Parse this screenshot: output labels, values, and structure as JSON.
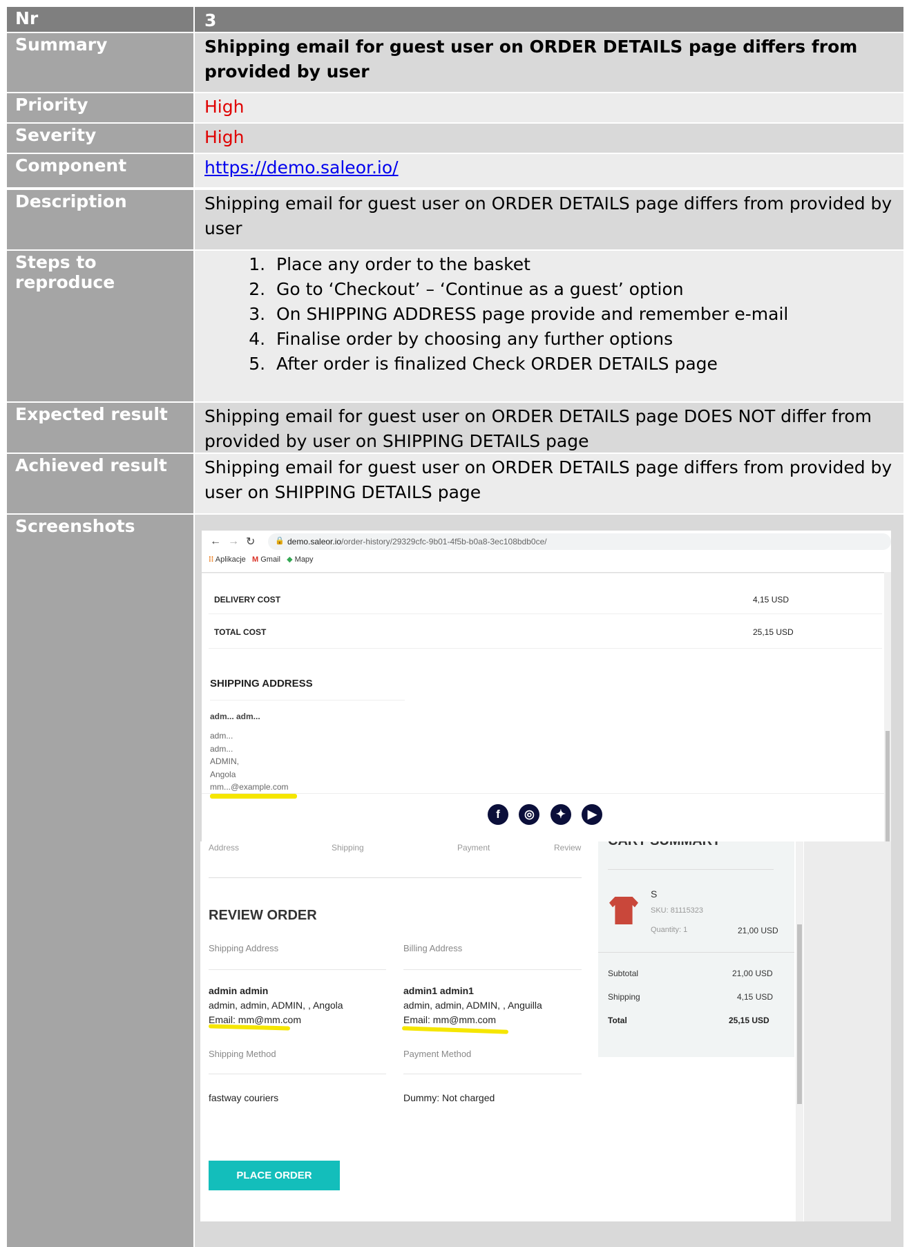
{
  "rows": {
    "nr": {
      "label": "Nr",
      "value": "3"
    },
    "summary": {
      "label": "Summary",
      "value": "Shipping email for guest user on ORDER DETAILS page differs from provided by user"
    },
    "priority": {
      "label": "Priority",
      "value": "High"
    },
    "severity": {
      "label": "Severity",
      "value": "High"
    },
    "component": {
      "label": "Component",
      "value": "https://demo.saleor.io/"
    },
    "description": {
      "label": "Description",
      "value": "Shipping email for guest user on ORDER DETAILS page differs from provided by user"
    },
    "steps": {
      "label": "Steps to reproduce",
      "items": [
        "Place any order to the basket",
        "Go to ‘Checkout’ – ‘Continue as a guest’ option",
        "On  SHIPPING ADDRESS page provide and remember e-mail",
        "Finalise order by choosing any further options",
        "After order is finalized Check ORDER DETAILS page"
      ]
    },
    "expected": {
      "label": "Expected result",
      "value": "Shipping email for guest user on ORDER DETAILS page DOES NOT differ from provided by user on SHIPPING DETAILS page"
    },
    "achieved": {
      "label": "Achieved result",
      "value": "Shipping email for guest user on ORDER DETAILS page differs from provided by user on SHIPPING DETAILS page"
    },
    "screenshots": {
      "label": "Screenshots"
    }
  },
  "shot1": {
    "url_host": "demo.saleor.io",
    "url_path": "/order-history/29329cfc-9b01-4f5b-b0a8-3ec108bdb0ce/",
    "bookmarks": [
      "Aplikacje",
      "Gmail",
      "Mapy"
    ],
    "delivery_label": "DELIVERY COST",
    "delivery_value": "4,15 USD",
    "total_label": "TOTAL COST",
    "total_value": "25,15 USD",
    "shipping_title": "SHIPPING ADDRESS",
    "address_name": "adm... adm...",
    "address_lines": [
      "adm...",
      "adm...",
      "ADMIN,",
      "Angola",
      "mm...@example.com"
    ],
    "social_icons": [
      "facebook-icon",
      "instagram-icon",
      "twitter-icon",
      "youtube-icon"
    ]
  },
  "shot2": {
    "steps": [
      "Address",
      "Shipping",
      "Payment",
      "Review"
    ],
    "cart_title": "CART SUMMARY",
    "review_title": "REVIEW ORDER",
    "shipping_address_label": "Shipping Address",
    "billing_address_label": "Billing Address",
    "ship_name": "admin admin",
    "ship_line": "admin, admin, ADMIN, , Angola",
    "ship_email": "Email: mm@mm.com",
    "bill_name": "admin1 admin1",
    "bill_line": "admin, admin, ADMIN, , Anguilla",
    "bill_email": "Email: mm@mm.com",
    "shipping_method_label": "Shipping Method",
    "shipping_method": "fastway couriers",
    "payment_method_label": "Payment Method",
    "payment_method": "Dummy: Not charged",
    "place_order": "PLACE ORDER",
    "product_name": "S",
    "sku": "SKU: 81115323",
    "quantity": "Quantity: 1",
    "product_price": "21,00 USD",
    "subtotal_label": "Subtotal",
    "subtotal_value": "21,00 USD",
    "shipping_label": "Shipping",
    "shipping_value": "4,15 USD",
    "total_label": "Total",
    "total_value": "25,15 USD"
  }
}
